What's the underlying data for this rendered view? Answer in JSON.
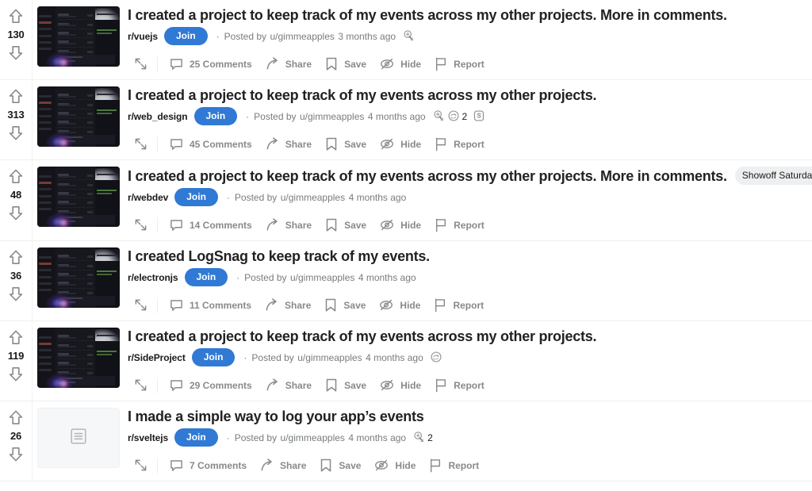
{
  "theme": {
    "accent": "#3079d4",
    "title_color": "#222222",
    "meta_color": "#787c7e",
    "action_color": "#878a8c",
    "divider": "#edeff1",
    "flair_bg": "#edeff1"
  },
  "actions": {
    "expand_label": "",
    "share_label": "Share",
    "save_label": "Save",
    "hide_label": "Hide",
    "report_label": "Report",
    "join_label": "Join",
    "posted_by_prefix": "Posted by",
    "separator_dot": "·"
  },
  "icons": {
    "upvote": "upvote-arrow-icon",
    "downvote": "downvote-arrow-icon",
    "expand": "expand-diagonal-arrows-icon",
    "comments": "comment-bubble-icon",
    "share": "share-arrow-icon",
    "save": "bookmark-icon",
    "hide": "eye-slash-icon",
    "report": "flag-icon",
    "text_post": "text-post-placeholder-icon",
    "award_silver": "silver-award-icon",
    "award_circle": "circle-award-icon",
    "award_s": "s-badge-award-icon"
  },
  "posts": [
    {
      "score": "130",
      "title": "I created a project to keep track of my events across my other projects. More in comments.",
      "flair": "",
      "subreddit": "r/vuejs",
      "author": "u/gimmeapples",
      "age": "3 months ago",
      "comments": "25 Comments",
      "thumb_type": "image",
      "awards": [
        {
          "kind": "silver",
          "count": ""
        }
      ]
    },
    {
      "score": "313",
      "title": "I created a project to keep track of my events across my other projects.",
      "flair": "",
      "subreddit": "r/web_design",
      "author": "u/gimmeapples",
      "age": "4 months ago",
      "comments": "45 Comments",
      "thumb_type": "image",
      "awards": [
        {
          "kind": "silver",
          "count": ""
        },
        {
          "kind": "circle",
          "count": "2"
        },
        {
          "kind": "sbadge",
          "count": ""
        }
      ]
    },
    {
      "score": "48",
      "title": "I created a project to keep track of my events across my other projects. More in comments.",
      "flair": "Showoff Saturday",
      "subreddit": "r/webdev",
      "author": "u/gimmeapples",
      "age": "4 months ago",
      "comments": "14 Comments",
      "thumb_type": "image",
      "awards": []
    },
    {
      "score": "36",
      "title": "I created LogSnag to keep track of my events.",
      "flair": "",
      "subreddit": "r/electronjs",
      "author": "u/gimmeapples",
      "age": "4 months ago",
      "comments": "11 Comments",
      "thumb_type": "image",
      "awards": []
    },
    {
      "score": "119",
      "title": "I created a project to keep track of my events across my other projects.",
      "flair": "",
      "subreddit": "r/SideProject",
      "author": "u/gimmeapples",
      "age": "4 months ago",
      "comments": "29 Comments",
      "thumb_type": "image",
      "awards": [
        {
          "kind": "circle",
          "count": ""
        }
      ]
    },
    {
      "score": "26",
      "title": "I made a simple way to log your app’s events",
      "flair": "",
      "subreddit": "r/sveltejs",
      "author": "u/gimmeapples",
      "age": "4 months ago",
      "comments": "7 Comments",
      "thumb_type": "text",
      "awards": [
        {
          "kind": "silver",
          "count": "2"
        }
      ]
    }
  ]
}
